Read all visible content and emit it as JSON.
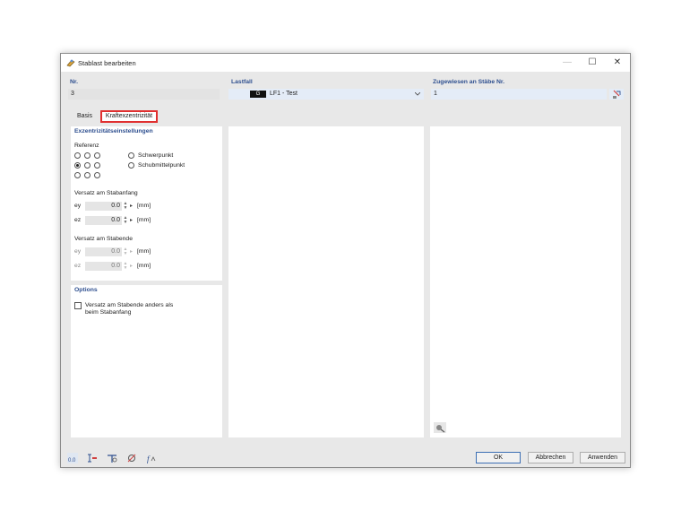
{
  "window": {
    "title": "Stablast bearbeiten",
    "minimize": "—",
    "maximize": "☐",
    "close": "✕"
  },
  "header": {
    "nr_label": "Nr.",
    "nr_value": "3",
    "lastfall_label": "Lastfall",
    "lastfall_tag": "G",
    "lastfall_value": "LF1 - Test",
    "zugewiesen_label": "Zugewiesen an Stäbe Nr.",
    "zugewiesen_value": "1"
  },
  "tabs": [
    {
      "label": "Basis"
    },
    {
      "label": "Kraftexzentrizität",
      "active": true
    }
  ],
  "exzentrizitaet": {
    "title": "Exzentrizitätseinstellungen",
    "referenz_label": "Referenz",
    "grid_selected_index": 3,
    "schwerpunkt": "Schwerpunkt",
    "schubmittelpunkt": "Schubmittelpunkt",
    "anfang_title": "Versatz am Stabanfang",
    "ende_title": "Versatz am Stabende",
    "ey_symbol": "ey",
    "ez_symbol": "ez",
    "anfang": {
      "ey": "0.0",
      "ez": "0.0"
    },
    "ende": {
      "ey": "0.0",
      "ez": "0.0"
    },
    "unit": "[mm]"
  },
  "options": {
    "title": "Options",
    "checkbox_line1": "Versatz am Stabende anders als",
    "checkbox_line2": "beim Stabanfang"
  },
  "footer": {
    "ok": "OK",
    "abbrechen": "Abbrechen",
    "anwenden": "Anwenden"
  },
  "colors": {
    "accent": "#2e4f8f",
    "highlight_tab": "#e03030"
  }
}
